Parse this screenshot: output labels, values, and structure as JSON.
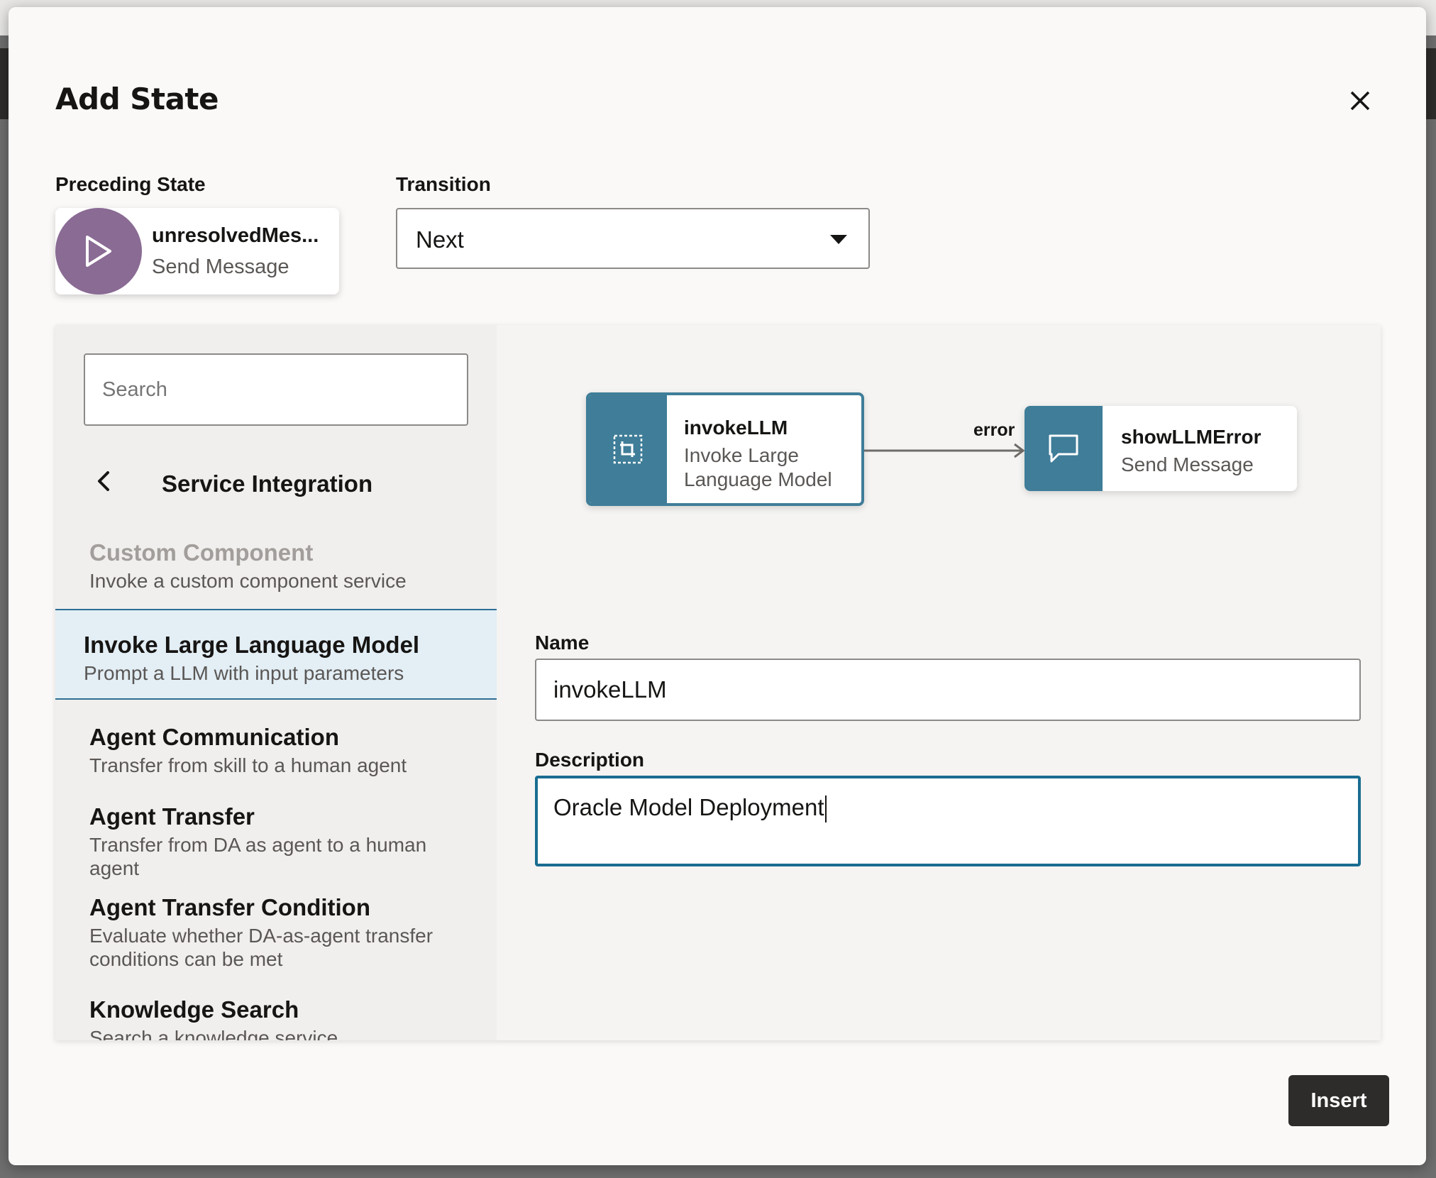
{
  "dialog": {
    "title": "Add State",
    "close_icon": "close-icon"
  },
  "preceding_state": {
    "label": "Preceding State",
    "name": "unresolvedMes...",
    "type": "Send Message",
    "icon": "play-icon",
    "color": "#8a6b94"
  },
  "transition": {
    "label": "Transition",
    "value": "Next"
  },
  "sidebar": {
    "search_placeholder": "Search",
    "category": "Service Integration",
    "items": [
      {
        "title": "Custom Component",
        "desc": "Invoke a custom component service",
        "state": "disabled"
      },
      {
        "title": "Invoke Large Language Model",
        "desc": "Prompt a LLM with input parameters",
        "state": "selected"
      },
      {
        "title": "Agent Communication",
        "desc": "Transfer from skill to a human agent",
        "state": "normal"
      },
      {
        "title": "Agent Transfer",
        "desc": "Transfer from DA as agent to a human agent",
        "state": "normal"
      },
      {
        "title": "Agent Transfer Condition",
        "desc": "Evaluate whether DA-as-agent transfer conditions can be met",
        "state": "normal"
      },
      {
        "title": "Knowledge Search",
        "desc": "Search a knowledge service",
        "state": "normal"
      }
    ]
  },
  "flow": {
    "nodes": [
      {
        "name": "invokeLLM",
        "type": "Invoke Large Language Model",
        "icon": "llm-component-icon"
      },
      {
        "name": "showLLMError",
        "type": "Send Message",
        "icon": "chat-bubble-icon"
      }
    ],
    "edge_label": "error",
    "accent": "#3f7d98"
  },
  "form": {
    "name_label": "Name",
    "name_value": "invokeLLM",
    "description_label": "Description",
    "description_value": "Oracle Model Deployment"
  },
  "footer": {
    "insert_label": "Insert"
  }
}
